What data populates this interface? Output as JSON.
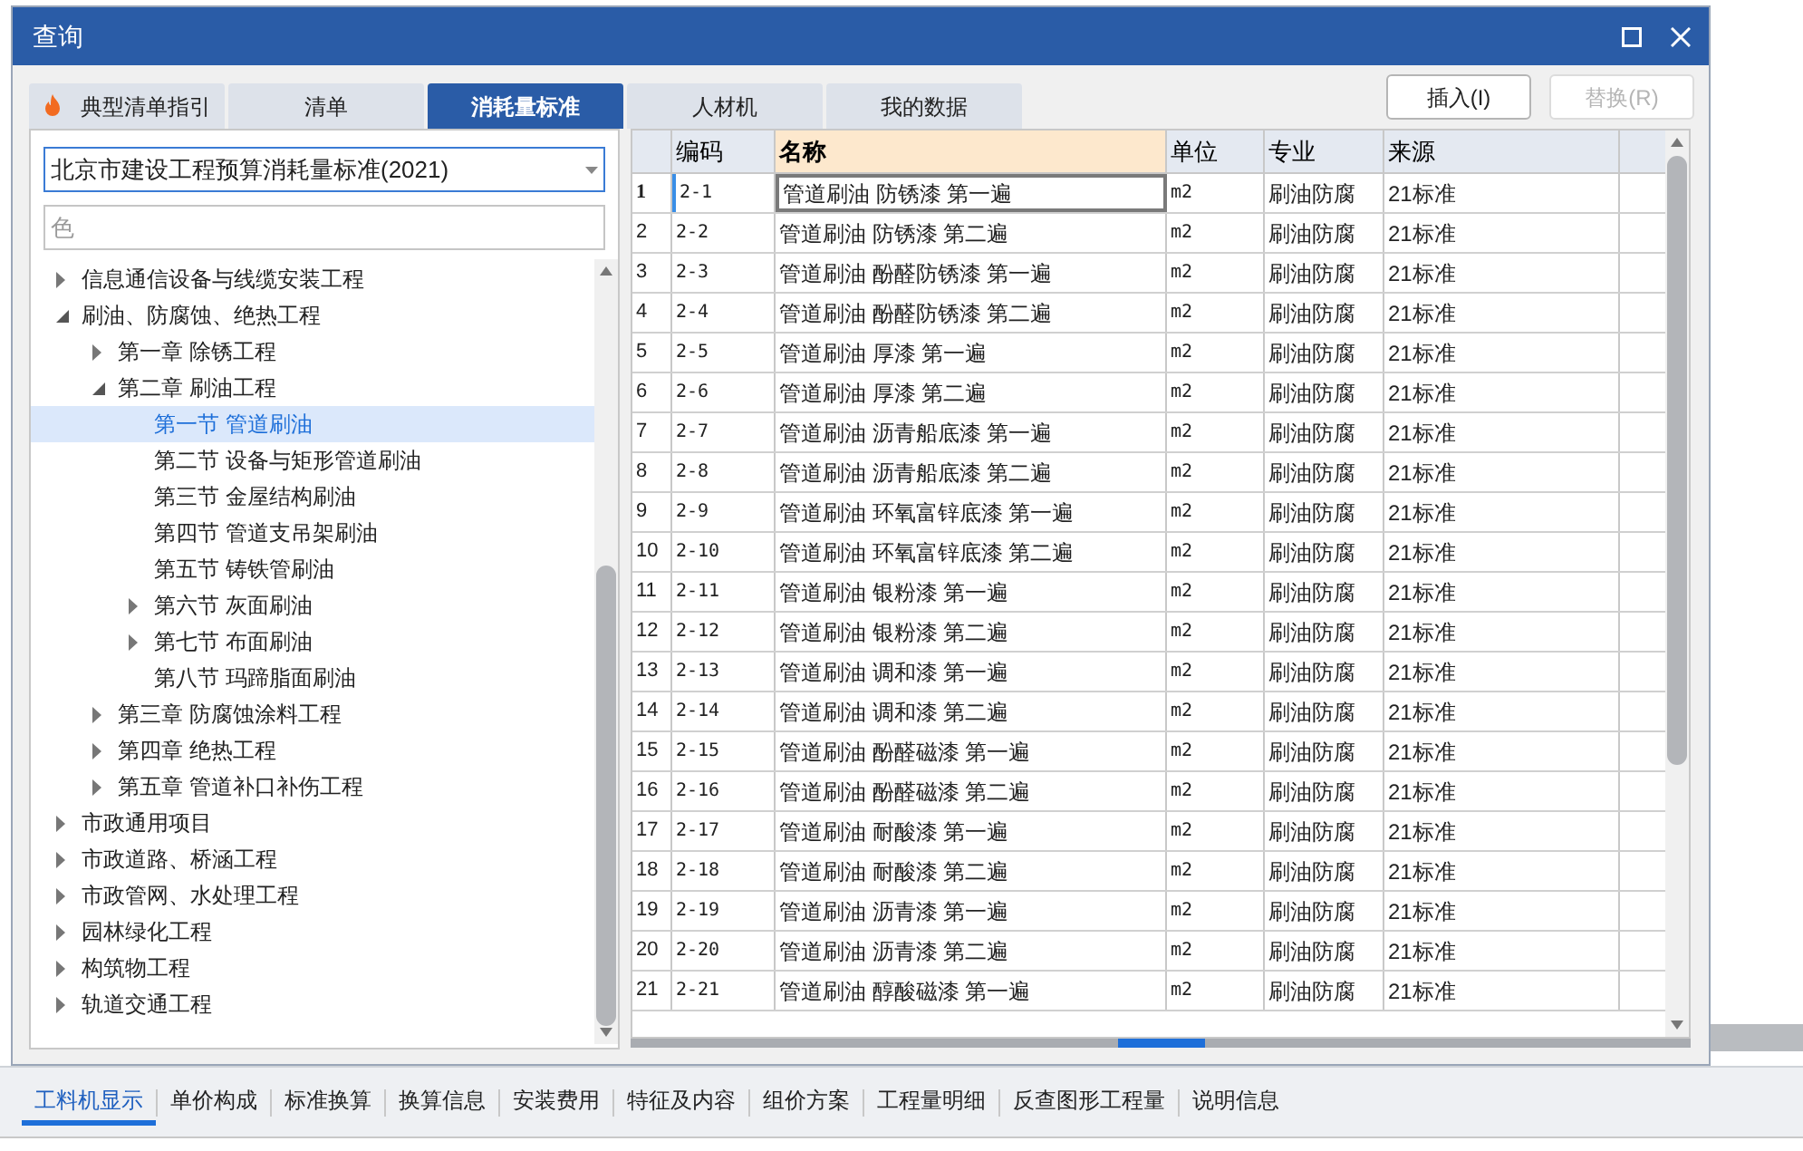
{
  "window": {
    "title": "查询"
  },
  "tabs": [
    {
      "label": "典型清单指引",
      "selected": false,
      "kind": "hot"
    },
    {
      "label": "清单",
      "selected": false,
      "kind": "plain"
    },
    {
      "label": "消耗量标准",
      "selected": true,
      "kind": "plain"
    },
    {
      "label": "人材机",
      "selected": false,
      "kind": "plain"
    },
    {
      "label": "我的数据",
      "selected": false,
      "kind": "plain"
    }
  ],
  "buttons": [
    {
      "label": "插入(I)",
      "disabled": false
    },
    {
      "label": "替换(R)",
      "disabled": true
    }
  ],
  "standard_select": {
    "value": "北京市建设工程预算消耗量标准(2021)"
  },
  "search": {
    "placeholder": "色"
  },
  "tree": [
    {
      "label": "信息通信设备与线缆安装工程",
      "expanded": false,
      "selected": false
    },
    {
      "label": "刷油、防腐蚀、绝热工程",
      "expanded": true,
      "selected": false,
      "children": [
        {
          "label": "第一章 除锈工程",
          "expanded": false,
          "selected": false
        },
        {
          "label": "第二章 刷油工程",
          "expanded": true,
          "selected": false,
          "children": [
            {
              "label": "第一节 管道刷油",
              "selected": true
            },
            {
              "label": "第二节 设备与矩形管道刷油",
              "selected": false
            },
            {
              "label": "第三节 金屋结构刷油",
              "selected": false
            },
            {
              "label": "第四节 管道支吊架刷油",
              "selected": false
            },
            {
              "label": "第五节 铸铁管刷油",
              "selected": false
            },
            {
              "label": "第六节 灰面刷油",
              "expanded": false,
              "selected": false
            },
            {
              "label": "第七节 布面刷油",
              "expanded": false,
              "selected": false
            },
            {
              "label": "第八节 玛蹄脂面刷油",
              "selected": false
            }
          ]
        },
        {
          "label": "第三章 防腐蚀涂料工程",
          "expanded": false,
          "selected": false
        },
        {
          "label": "第四章 绝热工程",
          "expanded": false,
          "selected": false
        },
        {
          "label": "第五章 管道补口补伤工程",
          "expanded": false,
          "selected": false
        }
      ]
    },
    {
      "label": "市政通用项目",
      "expanded": false,
      "selected": false
    },
    {
      "label": "市政道路、桥涵工程",
      "expanded": false,
      "selected": false
    },
    {
      "label": "市政管网、水处理工程",
      "expanded": false,
      "selected": false
    },
    {
      "label": "园林绿化工程",
      "expanded": false,
      "selected": false
    },
    {
      "label": "构筑物工程",
      "expanded": false,
      "selected": false
    },
    {
      "label": "轨道交通工程",
      "expanded": false,
      "selected": false
    }
  ],
  "table": {
    "columns": [
      {
        "label": "编码",
        "selected": false
      },
      {
        "label": "名称",
        "selected": true
      },
      {
        "label": "单位",
        "selected": false
      },
      {
        "label": "专业",
        "selected": false
      },
      {
        "label": "来源",
        "selected": false
      }
    ],
    "rows": [
      {
        "num": "1",
        "selected": true,
        "cells": [
          "2-1",
          "管道刷油 防锈漆 第一遍",
          "m2",
          "刷油防腐",
          "21标准"
        ]
      },
      {
        "num": "2",
        "selected": false,
        "cells": [
          "2-2",
          "管道刷油 防锈漆 第二遍",
          "m2",
          "刷油防腐",
          "21标准"
        ]
      },
      {
        "num": "3",
        "selected": false,
        "cells": [
          "2-3",
          "管道刷油 酚醛防锈漆 第一遍",
          "m2",
          "刷油防腐",
          "21标准"
        ]
      },
      {
        "num": "4",
        "selected": false,
        "cells": [
          "2-4",
          "管道刷油 酚醛防锈漆 第二遍",
          "m2",
          "刷油防腐",
          "21标准"
        ]
      },
      {
        "num": "5",
        "selected": false,
        "cells": [
          "2-5",
          "管道刷油 厚漆 第一遍",
          "m2",
          "刷油防腐",
          "21标准"
        ]
      },
      {
        "num": "6",
        "selected": false,
        "cells": [
          "2-6",
          "管道刷油 厚漆 第二遍",
          "m2",
          "刷油防腐",
          "21标准"
        ]
      },
      {
        "num": "7",
        "selected": false,
        "cells": [
          "2-7",
          "管道刷油 沥青船底漆 第一遍",
          "m2",
          "刷油防腐",
          "21标准"
        ]
      },
      {
        "num": "8",
        "selected": false,
        "cells": [
          "2-8",
          "管道刷油 沥青船底漆 第二遍",
          "m2",
          "刷油防腐",
          "21标准"
        ]
      },
      {
        "num": "9",
        "selected": false,
        "cells": [
          "2-9",
          "管道刷油 环氧富锌底漆 第一遍",
          "m2",
          "刷油防腐",
          "21标准"
        ]
      },
      {
        "num": "10",
        "selected": false,
        "cells": [
          "2-10",
          "管道刷油 环氧富锌底漆 第二遍",
          "m2",
          "刷油防腐",
          "21标准"
        ]
      },
      {
        "num": "11",
        "selected": false,
        "cells": [
          "2-11",
          "管道刷油 银粉漆 第一遍",
          "m2",
          "刷油防腐",
          "21标准"
        ]
      },
      {
        "num": "12",
        "selected": false,
        "cells": [
          "2-12",
          "管道刷油 银粉漆 第二遍",
          "m2",
          "刷油防腐",
          "21标准"
        ]
      },
      {
        "num": "13",
        "selected": false,
        "cells": [
          "2-13",
          "管道刷油 调和漆 第一遍",
          "m2",
          "刷油防腐",
          "21标准"
        ]
      },
      {
        "num": "14",
        "selected": false,
        "cells": [
          "2-14",
          "管道刷油 调和漆 第二遍",
          "m2",
          "刷油防腐",
          "21标准"
        ]
      },
      {
        "num": "15",
        "selected": false,
        "cells": [
          "2-15",
          "管道刷油 酚醛磁漆 第一遍",
          "m2",
          "刷油防腐",
          "21标准"
        ]
      },
      {
        "num": "16",
        "selected": false,
        "cells": [
          "2-16",
          "管道刷油 酚醛磁漆 第二遍",
          "m2",
          "刷油防腐",
          "21标准"
        ]
      },
      {
        "num": "17",
        "selected": false,
        "cells": [
          "2-17",
          "管道刷油 耐酸漆 第一遍",
          "m2",
          "刷油防腐",
          "21标准"
        ]
      },
      {
        "num": "18",
        "selected": false,
        "cells": [
          "2-18",
          "管道刷油 耐酸漆 第二遍",
          "m2",
          "刷油防腐",
          "21标准"
        ]
      },
      {
        "num": "19",
        "selected": false,
        "cells": [
          "2-19",
          "管道刷油 沥青漆 第一遍",
          "m2",
          "刷油防腐",
          "21标准"
        ]
      },
      {
        "num": "20",
        "selected": false,
        "cells": [
          "2-20",
          "管道刷油 沥青漆 第二遍",
          "m2",
          "刷油防腐",
          "21标准"
        ]
      },
      {
        "num": "21",
        "selected": false,
        "cells": [
          "2-21",
          "管道刷油 醇酸磁漆 第一遍",
          "m2",
          "刷油防腐",
          "21标准"
        ]
      }
    ]
  },
  "bottom_tabs": [
    {
      "label": "工料机显示",
      "selected": true
    },
    {
      "label": "单价构成",
      "selected": false
    },
    {
      "label": "标准换算",
      "selected": false
    },
    {
      "label": "换算信息",
      "selected": false
    },
    {
      "label": "安装费用",
      "selected": false
    },
    {
      "label": "特征及内容",
      "selected": false
    },
    {
      "label": "组价方案",
      "selected": false
    },
    {
      "label": "工程量明细",
      "selected": false
    },
    {
      "label": "反查图形工程量",
      "selected": false
    },
    {
      "label": "说明信息",
      "selected": false
    }
  ]
}
